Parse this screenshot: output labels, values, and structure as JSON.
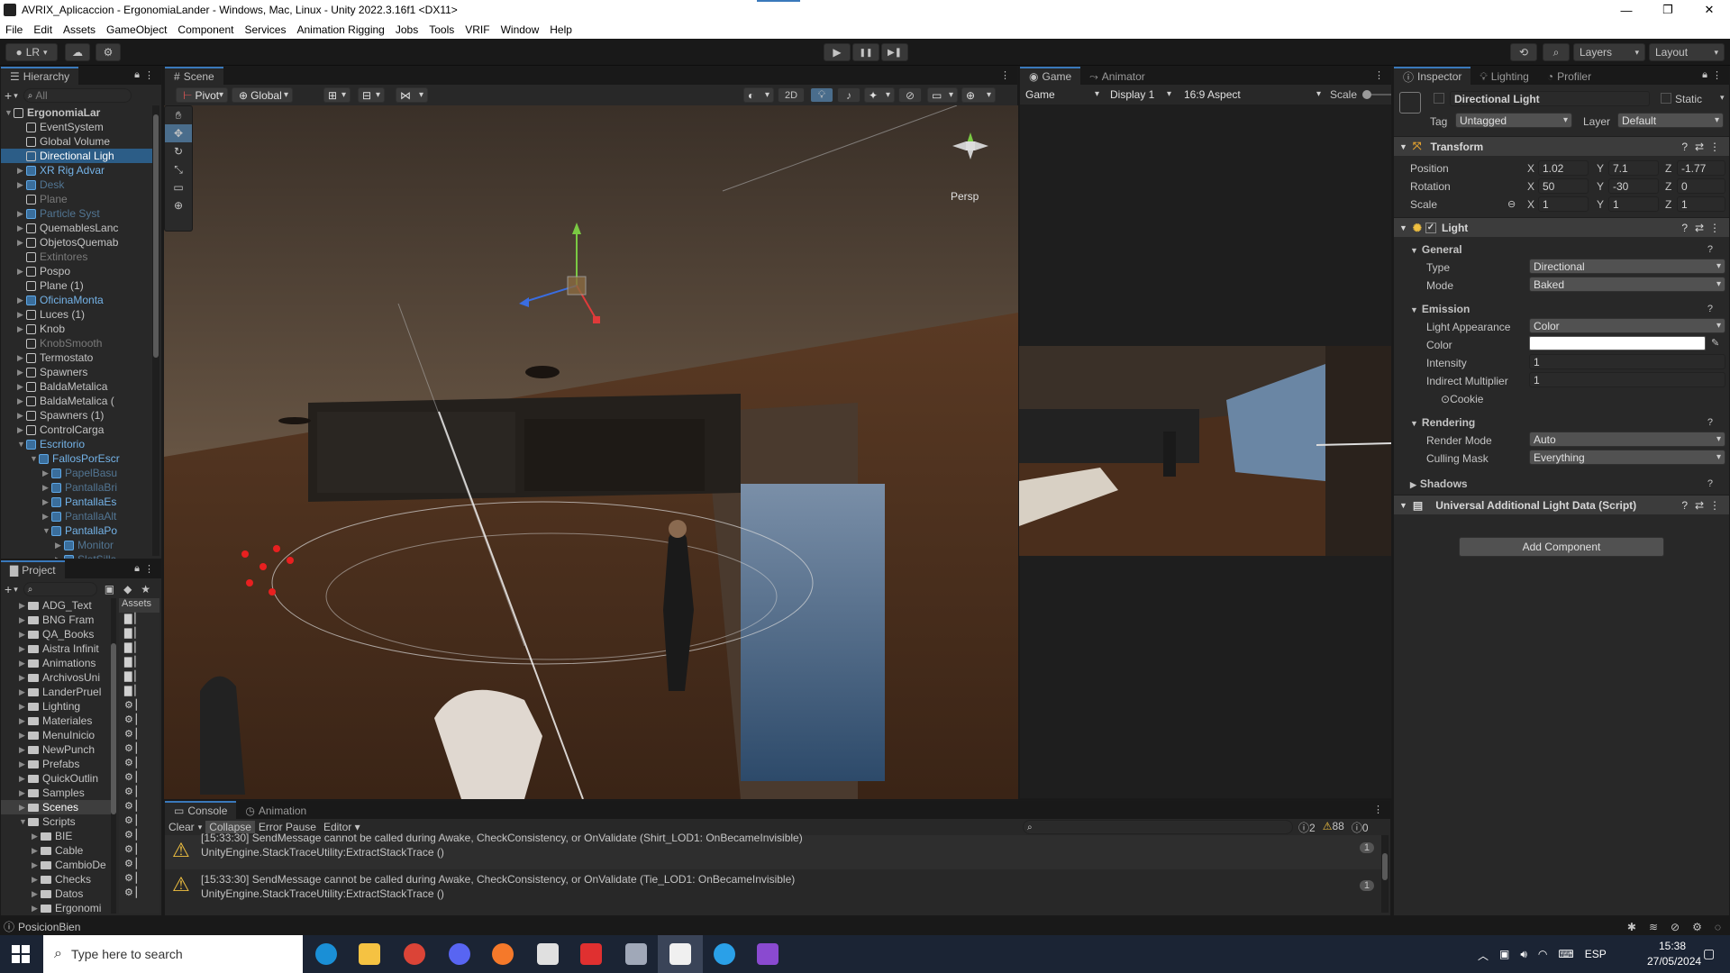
{
  "window": {
    "title": "AVRIX_Aplicaccion - ErgonomiaLander - Windows, Mac, Linux - Unity 2022.3.16f1 <DX11>",
    "minimize": "—",
    "maximize": "❐",
    "close": "✕"
  },
  "menu": [
    "File",
    "Edit",
    "Assets",
    "GameObject",
    "Component",
    "Services",
    "Animation Rigging",
    "Jobs",
    "Tools",
    "VRIF",
    "Window",
    "Help"
  ],
  "toolbar": {
    "account": "LR",
    "layers": "Layers",
    "layout": "Layout",
    "play": "▶",
    "pause": "❚❚",
    "step": "▶❚"
  },
  "hierarchy": {
    "tab": "Hierarchy",
    "search_placeholder": "All",
    "items": [
      {
        "label": "ErgonomiaLar",
        "indent": 0,
        "style": "scene"
      },
      {
        "label": "EventSystem",
        "indent": 1,
        "style": "normal"
      },
      {
        "label": "Global Volume",
        "indent": 1,
        "style": "normal"
      },
      {
        "label": "Directional Ligh",
        "indent": 1,
        "style": "selected"
      },
      {
        "label": "XR Rig Advar",
        "indent": 1,
        "style": "prefab"
      },
      {
        "label": "Desk",
        "indent": 1,
        "style": "prefab-dim"
      },
      {
        "label": "Plane",
        "indent": 1,
        "style": "dim"
      },
      {
        "label": "Particle Syst",
        "indent": 1,
        "style": "prefab-dim"
      },
      {
        "label": "QuemablesLanc",
        "indent": 1,
        "style": "normal"
      },
      {
        "label": "ObjetosQuemab",
        "indent": 1,
        "style": "normal"
      },
      {
        "label": "Extintores",
        "indent": 1,
        "style": "dim"
      },
      {
        "label": "Pospo",
        "indent": 1,
        "style": "normal"
      },
      {
        "label": "Plane (1)",
        "indent": 1,
        "style": "normal"
      },
      {
        "label": "OficinaMonta",
        "indent": 1,
        "style": "prefab"
      },
      {
        "label": "Luces (1)",
        "indent": 1,
        "style": "normal"
      },
      {
        "label": "Knob",
        "indent": 1,
        "style": "normal"
      },
      {
        "label": "KnobSmooth",
        "indent": 1,
        "style": "dim"
      },
      {
        "label": "Termostato",
        "indent": 1,
        "style": "normal"
      },
      {
        "label": "Spawners",
        "indent": 1,
        "style": "normal"
      },
      {
        "label": "BaldaMetalica",
        "indent": 1,
        "style": "normal"
      },
      {
        "label": "BaldaMetalica (",
        "indent": 1,
        "style": "normal"
      },
      {
        "label": "Spawners (1)",
        "indent": 1,
        "style": "normal"
      },
      {
        "label": "ControlCarga",
        "indent": 1,
        "style": "normal"
      },
      {
        "label": "Escritorio",
        "indent": 1,
        "style": "prefab"
      },
      {
        "label": "FallosPorEscr",
        "indent": 2,
        "style": "prefab"
      },
      {
        "label": "PapelBasu",
        "indent": 3,
        "style": "prefab-dim"
      },
      {
        "label": "PantallaBri",
        "indent": 3,
        "style": "prefab-dim"
      },
      {
        "label": "PantallaEs",
        "indent": 3,
        "style": "prefab"
      },
      {
        "label": "PantallaAlt",
        "indent": 3,
        "style": "prefab-dim"
      },
      {
        "label": "PantallaPo",
        "indent": 3,
        "style": "prefab"
      },
      {
        "label": "Monitor",
        "indent": 4,
        "style": "prefab-dim"
      },
      {
        "label": "SlotSilla",
        "indent": 4,
        "style": "prefab-dim"
      }
    ]
  },
  "project": {
    "tab": "Project",
    "breadcrumb": "Assets",
    "folders": [
      "ADG_Text",
      "BNG Fram",
      "QA_Books",
      "Aistra Infinit",
      "Animations",
      "ArchivosUni",
      "LanderPruel",
      "Lighting",
      "Materiales",
      "MenuInicio",
      "NewPunch",
      "Prefabs",
      "QuickOutlin",
      "Samples",
      "Scenes",
      "Scripts",
      "BIE",
      "Cable",
      "CambioDe",
      "Checks",
      "Datos",
      "Ergonomi"
    ]
  },
  "scene": {
    "tab": "Scene",
    "pivot": "Pivot",
    "global": "Global",
    "mode2d": "2D",
    "persp": "Persp"
  },
  "game": {
    "tab_game": "Game",
    "tab_animator": "Animator",
    "game_dd": "Game",
    "display": "Display 1",
    "aspect": "16:9 Aspect",
    "scale": "Scale"
  },
  "inspector": {
    "tabs": [
      "Inspector",
      "Lighting",
      "Profiler"
    ],
    "object_name": "Directional Light",
    "static": "Static",
    "tag_label": "Tag",
    "tag": "Untagged",
    "layer_label": "Layer",
    "layer": "Default",
    "transform": {
      "title": "Transform",
      "position_label": "Position",
      "position": [
        "1.02",
        "7.1",
        "-1.77"
      ],
      "rotation_label": "Rotation",
      "rotation": [
        "50",
        "-30",
        "0"
      ],
      "scale_label": "Scale",
      "scale": [
        "1",
        "1",
        "1"
      ]
    },
    "light": {
      "title": "Light",
      "general": "General",
      "type_label": "Type",
      "type": "Directional",
      "mode_label": "Mode",
      "mode": "Baked",
      "emission": "Emission",
      "appearance_label": "Light Appearance",
      "appearance": "Color",
      "color_label": "Color",
      "intensity_label": "Intensity",
      "intensity": "1",
      "indirect_label": "Indirect Multiplier",
      "indirect": "1",
      "cookie": "Cookie",
      "rendering": "Rendering",
      "render_mode_label": "Render Mode",
      "render_mode": "Auto",
      "culling_label": "Culling Mask",
      "culling": "Everything",
      "shadows": "Shadows"
    },
    "urp": "Universal Additional Light Data (Script)",
    "add_component": "Add Component"
  },
  "console": {
    "tabs": [
      "Console",
      "Animation"
    ],
    "clear": "Clear",
    "collapse": "Collapse",
    "error_pause": "Error Pause",
    "editor": "Editor",
    "counts": {
      "info": "2",
      "warn": "88",
      "err": "0"
    },
    "messages": [
      {
        "line1": "[15:33:30] SendMessage cannot be called during Awake, CheckConsistency, or OnValidate (Shirt_LOD1: OnBecameInvisible)",
        "line2": "UnityEngine.StackTraceUtility:ExtractStackTrace ()",
        "count": "1"
      },
      {
        "line1": "[15:33:30] SendMessage cannot be called during Awake, CheckConsistency, or OnValidate (Tie_LOD1: OnBecameInvisible)",
        "line2": "UnityEngine.StackTraceUtility:ExtractStackTrace ()",
        "count": "1"
      }
    ]
  },
  "statusbar": {
    "text": "PosicionBien"
  },
  "taskbar": {
    "search_placeholder": "Type here to search",
    "lang": "ESP",
    "time": "15:38",
    "date": "27/05/2024"
  }
}
